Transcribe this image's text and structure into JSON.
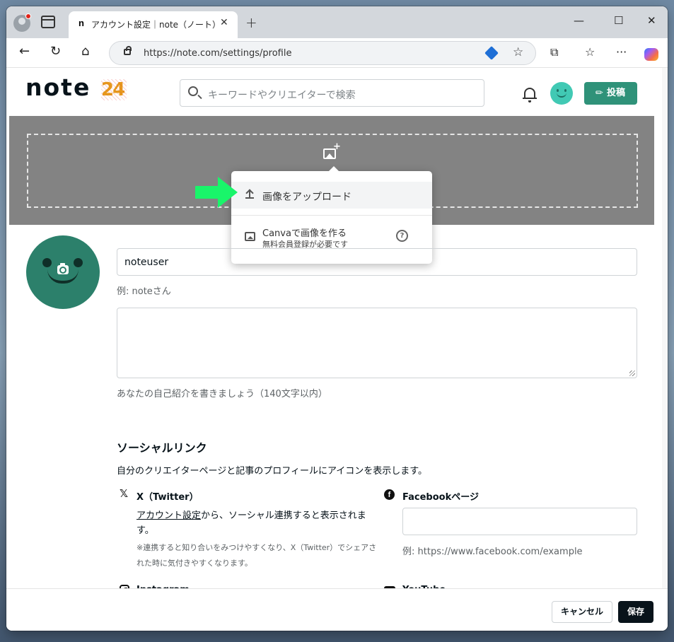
{
  "browser": {
    "tab_favicon": "n",
    "tab_title": "アカウント設定｜note（ノート）",
    "tab_close": "✕",
    "new_tab": "+",
    "url": "https://note.com/settings/profile",
    "win_minimize": "—",
    "win_maximize": "☐",
    "win_close": "✕",
    "back": "←",
    "reload": "↻",
    "home": "⌂",
    "favorite_star": "☆",
    "extensions": "⧉",
    "favorites": "☆",
    "more": "···"
  },
  "header": {
    "logo": "note",
    "logo_badge": "24",
    "search_placeholder": "キーワードやクリエイターで検索",
    "post_label": "投稿",
    "post_icon": "✎"
  },
  "cover_menu": {
    "upload_label": "画像をアップロード",
    "canva_label": "Canvaで画像を作る",
    "canva_sub": "無料会員登録が必要です",
    "help": "?"
  },
  "profile": {
    "name_value": "noteuser",
    "name_hint": "例: noteさん",
    "bio_value": "",
    "bio_hint": "あなたの自己紹介を書きましょう（140文字以内）"
  },
  "social": {
    "title": "ソーシャルリンク",
    "description": "自分のクリエイターページと記事のプロフィールにアイコンを表示します。",
    "x_icon": "𝕏",
    "x_label": "X（Twitter）",
    "x_link": "アカウント設定",
    "x_body": "から、ソーシャル連携すると表示されます。",
    "x_note": "※連携すると知り合いをみつけやすくなり、X（Twitter）でシェアされた時に気付きやすくなります。",
    "fb_icon": "f",
    "fb_label": "Facebookページ",
    "fb_value": "",
    "fb_hint": "例: https://www.facebook.com/example",
    "ig_label": "Instagram",
    "yt_label": "YouTube"
  },
  "footer": {
    "cancel_label": "キャンセル",
    "save_label": "保存"
  },
  "colors": {
    "brand_green": "#2f9279",
    "avatar_green": "#2c806b",
    "cover_gray": "#838383",
    "arrow_green": "#19f56a"
  }
}
